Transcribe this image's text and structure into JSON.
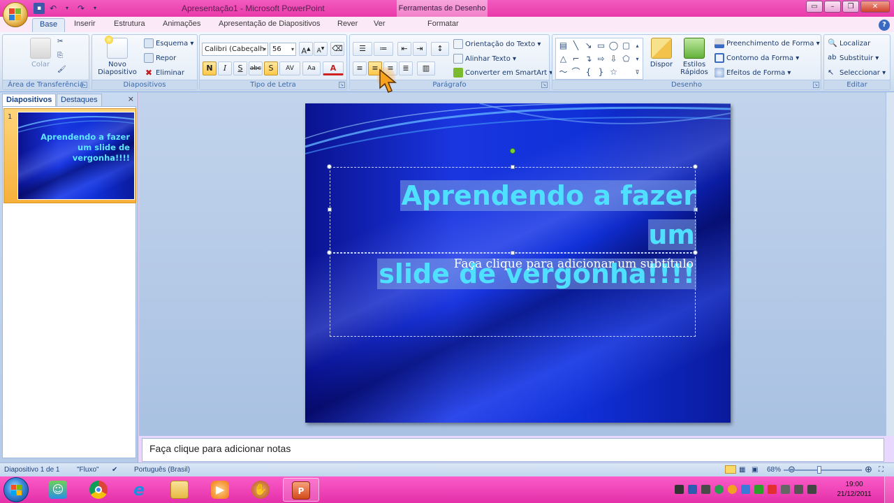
{
  "window": {
    "title": "Apresentação1 - Microsoft PowerPoint",
    "context_title": "Ferramentas de Desenho"
  },
  "tabs": [
    "Base",
    "Inserir",
    "Estrutura",
    "Animações",
    "Apresentação de Diapositivos",
    "Rever",
    "Ver",
    "Formatar"
  ],
  "ribbon": {
    "clipboard": {
      "label": "Área de Transferência",
      "paste": "Colar"
    },
    "slides": {
      "label": "Diapositivos",
      "new_slide": "Novo",
      "new_slide_2": "Diapositivo",
      "layout": "Esquema",
      "reset": "Repor",
      "delete": "Eliminar"
    },
    "font": {
      "label": "Tipo de Letra",
      "font_name": "Calibri (Cabeçalh",
      "font_size": "56",
      "bold": "N",
      "italic": "I",
      "underline": "S",
      "strike": "abc",
      "shadow": "S",
      "spacing": "AV",
      "case": "Aa"
    },
    "paragraph": {
      "label": "Parágrafo",
      "text_direction": "Orientação do Texto",
      "align_text": "Alinhar Texto",
      "smartart": "Converter em SmartArt"
    },
    "drawing": {
      "label": "Desenho",
      "arrange": "Dispor",
      "quick_styles": "Estilos",
      "quick_styles_2": "Rápidos",
      "shape_fill": "Preenchimento de Forma",
      "shape_outline": "Contorno da Forma",
      "shape_effects": "Efeitos de Forma"
    },
    "editing": {
      "label": "Editar",
      "find": "Localizar",
      "replace": "Substituir",
      "select": "Seleccionar"
    }
  },
  "left_panel": {
    "tabs": [
      "Diapositivos",
      "Destaques"
    ],
    "close": "×",
    "thumbnail": {
      "number": "1",
      "title": "Aprendendo a fazer um slide de vergonha!!!!"
    }
  },
  "slide": {
    "title_line1": "Aprendendo a fazer um",
    "title_line2": "slide de vergonha!!!!",
    "subtitle_placeholder": "Faça clique para adicionar um subtítulo"
  },
  "notes_placeholder": "Faça clique para adicionar notas",
  "status": {
    "slide_count": "Diapositivo 1 de 1",
    "theme": "\"Fluxo\"",
    "language": "Português (Brasil)",
    "zoom": "68%"
  },
  "taskbar": {
    "time": "19:00",
    "date": "21/12/2011"
  },
  "colors": {
    "title_text": "#4fe0ff",
    "slide_blue": "#1a36e0",
    "taskbar_pink": "#e42fa9"
  }
}
